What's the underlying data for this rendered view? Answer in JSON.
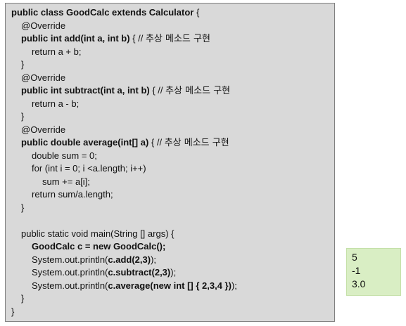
{
  "code": {
    "l01_p1": "public class GoodCalc extends Calculator",
    "l01_p2": " {",
    "l02": "@Override",
    "l03_p1": "public int add(int a, int b)",
    "l03_p2": " { // ",
    "l03_p3": "추상 메소드 구현",
    "l04": "return a + b;",
    "l05": "}",
    "l06": "@Override",
    "l07_p1": "public int subtract(int a, int b)",
    "l07_p2": " { // ",
    "l07_p3": "추상 메소드 구현",
    "l08": "return a - b;",
    "l09": "}",
    "l10": "@Override",
    "l11_p1": "public double average(int[] a)",
    "l11_p2": " { // ",
    "l11_p3": "추상 메소드 구현",
    "l12": "double sum = 0;",
    "l13": "for (int i = 0; i <a.length; i++)",
    "l14": "sum += a[i];",
    "l15": "return sum/a.length;",
    "l16": "}",
    "l18": "public static void main(String [] args) {",
    "l19": "GoodCalc c = new GoodCalc();",
    "l20_p1": "System.out.println(",
    "l20_p2": "c.add(2,3)",
    "l20_p3": ");",
    "l21_p1": "System.out.println(",
    "l21_p2": "c.subtract(2,3)",
    "l21_p3": ");",
    "l22_p1": "System.out.println(",
    "l22_p2": "c.average(new int [] { 2,3,4 })",
    "l22_p3": ");",
    "l23": "}",
    "l24": "}"
  },
  "output": [
    "5",
    "-1",
    "3.0"
  ],
  "colors": {
    "code_bg": "#d9d9d9",
    "output_bg": "#d9eec4"
  }
}
